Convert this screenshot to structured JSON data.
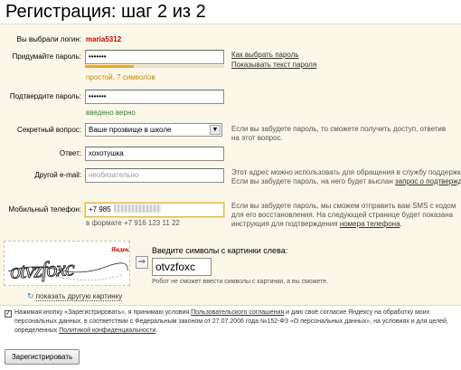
{
  "header": {
    "title": "Регистрация: шаг 2 из 2"
  },
  "login": {
    "label": "Вы выбрали логин:",
    "value": "maria5312"
  },
  "password": {
    "label": "Придумайте пароль:",
    "value": "•••••••",
    "strength_level": 0.35,
    "strength_text": "простой, 7 символов",
    "how_to_choose_link": "Как выбрать пароль",
    "show_text_link": "Показывать текст пароля"
  },
  "confirm_password": {
    "label": "Подтвердите пароль:",
    "value": "•••••••",
    "status": "введено верно"
  },
  "secret_question": {
    "label": "Секретный вопрос:",
    "selected": "Ваше прозвище в школе",
    "hint": "Если вы забудете пароль, то сможете получить доступ, ответив на этот вопрос."
  },
  "answer": {
    "label": "Ответ:",
    "value": "хохотушка"
  },
  "other_email": {
    "label": "Другой e-mail:",
    "placeholder": "необязательно",
    "hint_line1": "Этот адрес можно использовать для обращения в службу поддержки.",
    "hint_line2_prefix": "Если вы забудете пароль, на него будет выслан ",
    "hint_link": "запрос о подтверждении",
    "hint_suffix": "."
  },
  "mobile_phone": {
    "label": "Мобильный телефон:",
    "value_prefix": "+7 985",
    "format_hint": "в формате +7 916 123 11 22",
    "hint_line1": "Если вы забудете пароль, мы сможем отправить вам SMS с кодом",
    "hint_line2": "для его восстановления. На следующей странице будет показана",
    "hint_line3_prefix": "инструкция для подтверждения ",
    "hint_link": "номера телефона",
    "hint_suffix": "."
  },
  "captcha": {
    "brand": "Яндекс",
    "image_text": "otvzfoxc",
    "prompt": "Введите символы с картинки слева:",
    "value": "otvzfoxc",
    "note": "Робот не сможет ввести символы с картинки, а вы сможете.",
    "refresh_link": "показать другую картинку"
  },
  "terms": {
    "checked": "✓",
    "line1_prefix": "Нажимая кнопку «Зарегистрировать», я принимаю условия ",
    "agreement_link": "Пользовательского соглашения",
    "line1_suffix": " и даю своё согласие Яндексу на обработку моих",
    "line2": "персональных данных, в соответствии с Федеральным законом от 27.07.2006 года №152-ФЗ «О персональных данных», на условиях и для целей,",
    "line3_prefix": "определенных ",
    "policy_link": "Политикой конфиденциальности",
    "line3_suffix": "."
  },
  "submit_label": "Зарегистрировать",
  "colors": {
    "panel_bg": "#faf7e8",
    "login_red": "#cc0000",
    "strength_orange": "#e8a72a",
    "ok_green": "#2f8a2f"
  }
}
